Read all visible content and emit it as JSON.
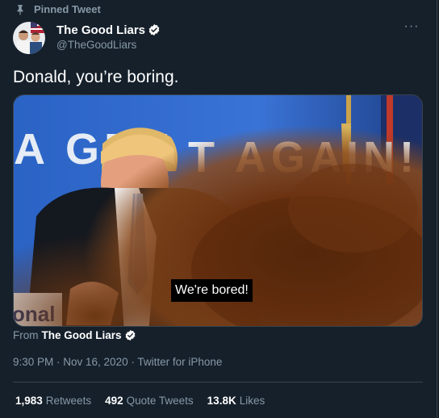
{
  "pinned": {
    "label": "Pinned Tweet",
    "icon": "pin-icon"
  },
  "author": {
    "name": "The Good Liars",
    "handle": "@TheGoodLiars",
    "verified": true
  },
  "tweet": {
    "text": "Donald, you’re boring."
  },
  "media": {
    "banner_text": "A GRE T AGAIN!",
    "partial_sign": "onal",
    "caption": "We're bored!"
  },
  "attribution": {
    "from_label": "From",
    "from_name": "The Good Liars"
  },
  "meta": {
    "text": "9:30 PM · Nov 16, 2020 · Twitter for iPhone"
  },
  "stats": [
    {
      "value": "1,983",
      "label": "Retweets"
    },
    {
      "value": "492",
      "label": "Quote Tweets"
    },
    {
      "value": "13.8K",
      "label": "Likes"
    }
  ],
  "colors": {
    "background": "#15202b",
    "secondary_text": "#8899a6",
    "divider": "#38444d",
    "verified": "#ffffff"
  }
}
